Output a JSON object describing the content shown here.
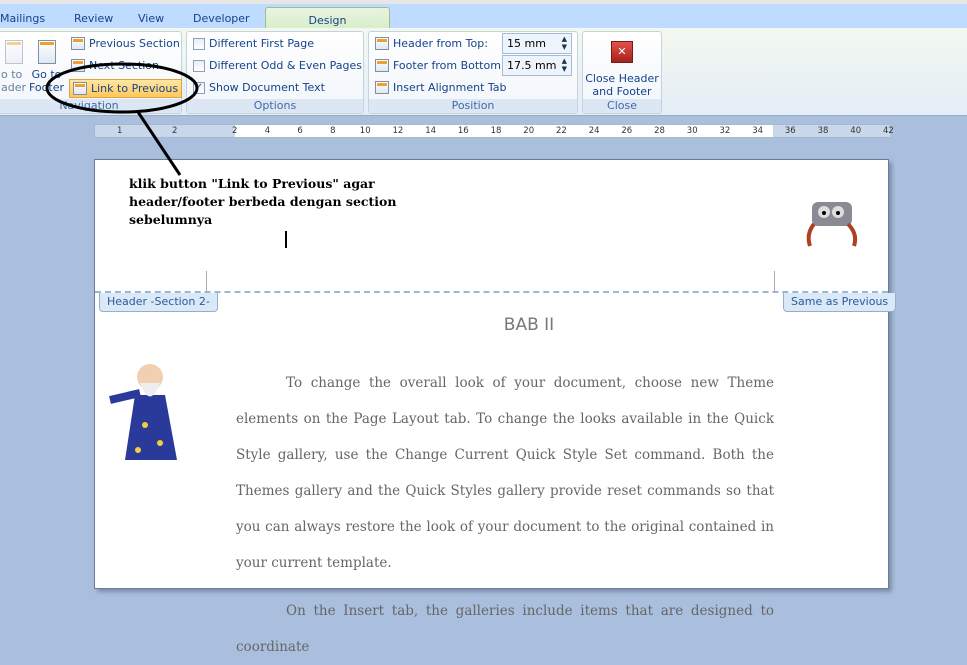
{
  "tabs": [
    "Mailings",
    "Review",
    "View",
    "Developer",
    "Design"
  ],
  "navigation": {
    "goto_header": "o to\nader",
    "goto_footer": "Go to\nFooter",
    "previous_section": "Previous Section",
    "next_section": "Next Section",
    "link_to_previous": "Link to Previous",
    "label": "Navigation"
  },
  "options": {
    "different_first_page": {
      "label": "Different First Page",
      "checked": false
    },
    "different_odd_even": {
      "label": "Different Odd & Even Pages",
      "checked": false
    },
    "show_document_text": {
      "label": "Show Document Text",
      "checked": true
    },
    "label": "Options"
  },
  "position": {
    "header_from_top": "Header from Top:",
    "header_value": "15 mm",
    "footer_from_bottom": "Footer from Bottom:",
    "footer_value": "17.5 mm",
    "insert_alignment_tab": "Insert Alignment Tab",
    "label": "Position"
  },
  "close": {
    "button": "Close Header and Footer",
    "label": "Close"
  },
  "ruler": [
    "1",
    "2",
    "2",
    "4",
    "6",
    "8",
    "10",
    "12",
    "14",
    "16",
    "18",
    "20",
    "22",
    "24",
    "26",
    "28",
    "30",
    "32",
    "34",
    "36",
    "38",
    "40",
    "42"
  ],
  "annotation": "klik button \"Link to Previous\" agar header/footer berbeda dengan section sebelumnya",
  "header_tab": "Header -Section 2-",
  "same_as_previous": "Same as Previous",
  "document": {
    "title": "BAB II",
    "paragraphs": [
      "To change the overall look of your document, choose new Theme elements on the Page Layout tab. To change the looks available in the Quick Style gallery, use the Change Current Quick Style Set command. Both the Themes gallery and the Quick Styles gallery provide reset commands so that you can always restore the look of your document to the original contained in your current template.",
      "On the Insert tab, the galleries include items that are designed to coordinate"
    ]
  }
}
